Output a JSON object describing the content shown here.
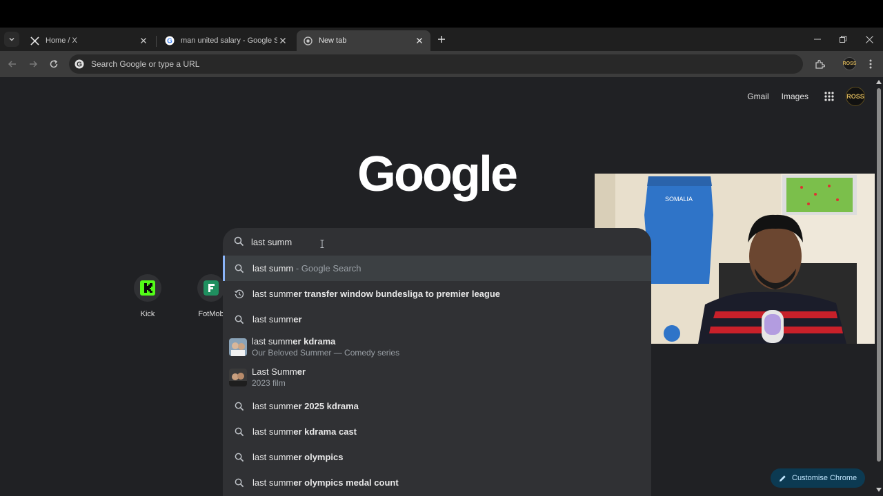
{
  "tabs": [
    {
      "title": "Home / X",
      "favicon": "x-logo-icon",
      "active": false
    },
    {
      "title": "man united salary - Google Sea",
      "favicon": "google-g-icon",
      "active": false
    },
    {
      "title": "New tab",
      "favicon": "chrome-icon",
      "active": true
    }
  ],
  "omnibox": {
    "placeholder": "Search Google or type a URL"
  },
  "profile_badge": "ROSS",
  "top_links": {
    "gmail": "Gmail",
    "images": "Images"
  },
  "logo_text": "Google",
  "search": {
    "query": "last summ"
  },
  "suggestions": [
    {
      "icon": "search-icon",
      "text": "last summ",
      "muted": " - Google Search",
      "highlighted": true
    },
    {
      "icon": "history-icon",
      "prefix": "last summ",
      "bold": "er transfer window bundesliga to premier league"
    },
    {
      "icon": "search-icon",
      "prefix": "last summ",
      "bold": "er"
    },
    {
      "icon": "thumbnail",
      "prefix": "last summ",
      "bold": "er kdrama",
      "sub": "Our Beloved Summer — Comedy series"
    },
    {
      "icon": "thumbnail",
      "prefix": "Last Summ",
      "bold": "er",
      "sub": "2023 film"
    },
    {
      "icon": "search-icon",
      "prefix": "last summ",
      "bold": "er 2025 kdrama"
    },
    {
      "icon": "search-icon",
      "prefix": "last summ",
      "bold": "er kdrama cast"
    },
    {
      "icon": "search-icon",
      "prefix": "last summ",
      "bold": "er olympics"
    },
    {
      "icon": "search-icon",
      "prefix": "last summ",
      "bold": "er olympics medal count"
    }
  ],
  "shortcuts": [
    {
      "label": "Kick",
      "icon": "kick-icon"
    },
    {
      "label": "FotMob",
      "icon": "fotmob-icon"
    }
  ],
  "customise_label": "Customise Chrome",
  "webcam_jersey_text": "SOMALIA",
  "colors": {
    "accent": "#8ab4f8",
    "kick": "#53fc18",
    "fotmob": "#1f8f5f",
    "customise_bg": "#0c3a52"
  }
}
